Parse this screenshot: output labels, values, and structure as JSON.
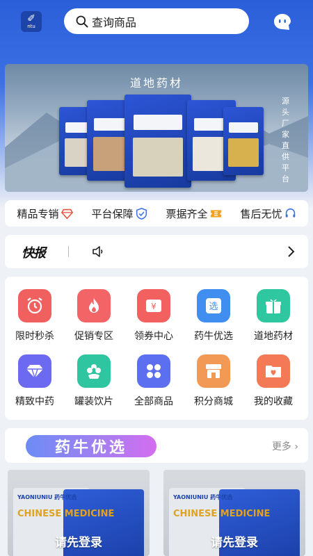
{
  "header": {
    "logo_mark": "✐",
    "logo_text": "ntu",
    "search_placeholder": "查询商品"
  },
  "banner": {
    "title": "道地药材",
    "side_text": "源头厂家直供平台"
  },
  "features": [
    {
      "label": "精品专销",
      "icon": "diamond-icon",
      "color": "#e8533e"
    },
    {
      "label": "平台保障",
      "icon": "shield-icon",
      "color": "#3a72e6"
    },
    {
      "label": "票据齐全",
      "icon": "ticket-icon",
      "color": "#f2a31b"
    },
    {
      "label": "售后无忧",
      "icon": "headset-icon",
      "color": "#3a72e6"
    }
  ],
  "news": {
    "brand": "快报"
  },
  "grid": [
    {
      "label": "限时秒杀",
      "icon": "alarm-clock-icon",
      "color": "#f0605f"
    },
    {
      "label": "促销专区",
      "icon": "flame-icon",
      "color": "#f26466"
    },
    {
      "label": "领券中心",
      "icon": "coupon-icon",
      "color": "#f2615f"
    },
    {
      "label": "药牛优选",
      "icon": "select-icon",
      "color": "#3f8ef0"
    },
    {
      "label": "道地药材",
      "icon": "gift-icon",
      "color": "#2fc7a0"
    },
    {
      "label": "精致中药",
      "icon": "gem-icon",
      "color": "#6b6af0"
    },
    {
      "label": "罐装饮片",
      "icon": "flower-icon",
      "color": "#2ec5a0"
    },
    {
      "label": "全部商品",
      "icon": "clover-icon",
      "color": "#5c6ff0"
    },
    {
      "label": "积分商城",
      "icon": "store-icon",
      "color": "#f29a55"
    },
    {
      "label": "我的收藏",
      "icon": "folder-heart-icon",
      "color": "#f47a57"
    }
  ],
  "section": {
    "title": "药牛优选",
    "more": "更多"
  },
  "products": [
    {
      "login_hint": "请先登录",
      "bag_text": "CHINESE MEDICINE",
      "brand_text": "YAONIUNIU 药牛优选"
    },
    {
      "login_hint": "请先登录",
      "bag_text": "CHINESE MEDICINE",
      "brand_text": "YAONIUNIU 药牛优选"
    }
  ]
}
